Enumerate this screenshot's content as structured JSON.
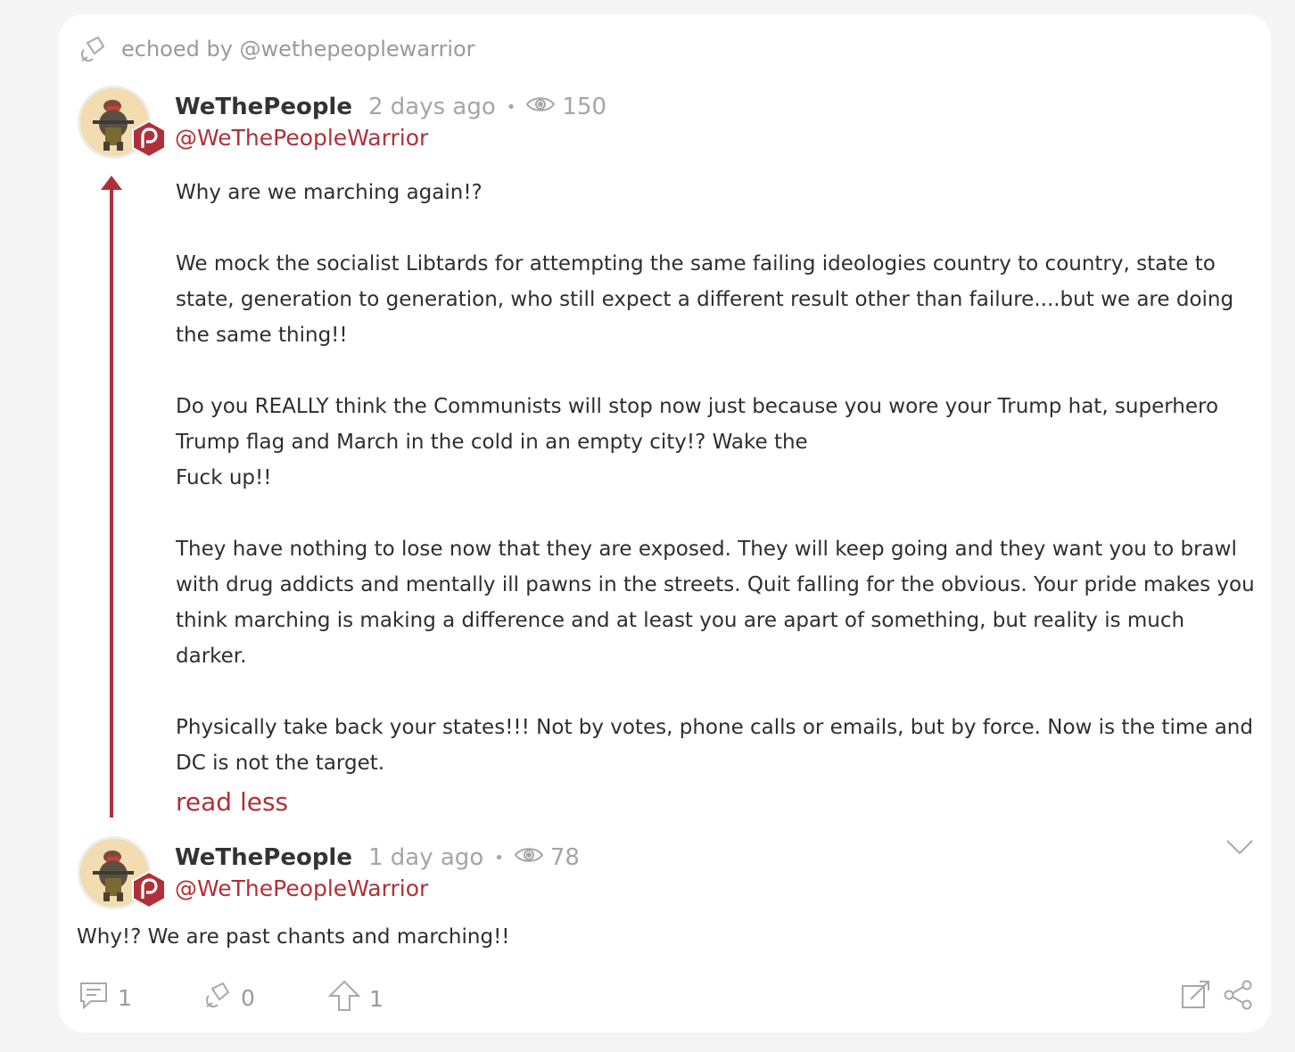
{
  "echo": {
    "text": "echoed by @wethepeoplewarrior"
  },
  "post": {
    "name": "WeThePeople",
    "time": "2 days ago",
    "views": "150",
    "handle": "@WeThePeopleWarrior",
    "paragraphs": [
      "Why are we marching again!?",
      "We mock the socialist Libtards for attempting the same failing ideologies country to country, state to state, generation to generation, who still expect a different result other than failure....but we are doing the same thing!!",
      "Do you REALLY think the Communists will stop now just because you wore your Trump hat, superhero Trump flag and March in the cold in an empty city!? Wake the\nFuck up!!",
      "They have nothing to lose now that they are exposed. They will keep going and they want you to brawl with drug addicts and mentally ill pawns in the streets. Quit falling for the obvious. Your pride makes you think marching is making a difference and at least you are apart of something, but reality is much darker.",
      "Physically take back your states!!! Not by votes, phone calls or emails, but by force. Now is the time and DC is not the target."
    ],
    "read_less": "read less"
  },
  "reply": {
    "name": "WeThePeople",
    "time": "1 day ago",
    "views": "78",
    "handle": "@WeThePeopleWarrior",
    "text": "Why!? We are past chants and marching!!"
  },
  "actions": {
    "comments": "1",
    "echoes": "0",
    "upvotes": "1"
  },
  "colors": {
    "accent": "#b03039",
    "muted": "#9a9a9a",
    "card": "#ffffff",
    "background": "#f5f5f5"
  }
}
